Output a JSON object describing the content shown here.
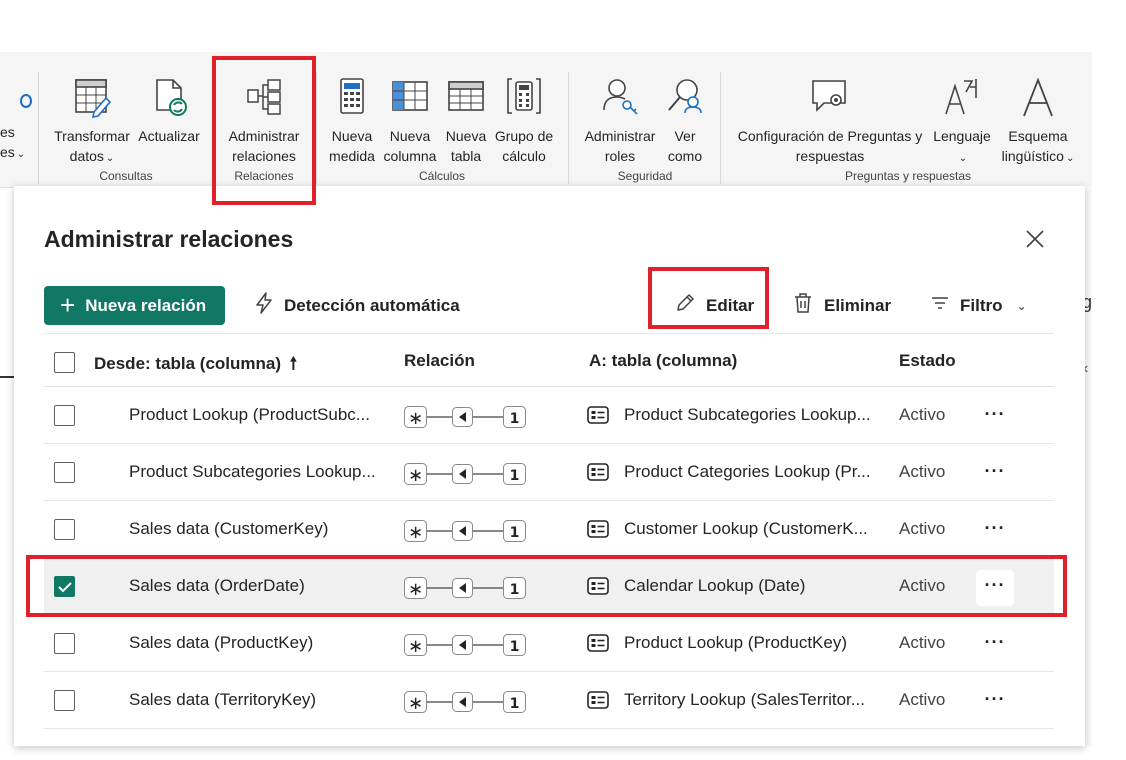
{
  "ribbon": {
    "partial_left": {
      "line1": "es",
      "line2": "es"
    },
    "transform": {
      "line1": "Transformar",
      "line2": "datos"
    },
    "refresh": {
      "line1": "Actualizar"
    },
    "manage_rel": {
      "line1": "Administrar",
      "line2": "relaciones"
    },
    "new_measure": {
      "line1": "Nueva",
      "line2": "medida"
    },
    "new_column": {
      "line1": "Nueva",
      "line2": "columna"
    },
    "new_table": {
      "line1": "Nueva",
      "line2": "tabla"
    },
    "calc_group": {
      "line1": "Grupo de",
      "line2": "cálculo"
    },
    "manage_roles": {
      "line1": "Administrar",
      "line2": "roles"
    },
    "view_as": {
      "line1": "Ver",
      "line2": "como"
    },
    "qa_config": {
      "line1": "Configuración de Preguntas y",
      "line2": "respuestas"
    },
    "language": {
      "line1": "Lenguaje"
    },
    "schema": {
      "line1": "Esquema",
      "line2": "lingüístico"
    },
    "groups": {
      "consultas": "Consultas",
      "relaciones": "Relaciones",
      "calculos": "Cálculos",
      "seguridad": "Seguridad",
      "qa": "Preguntas y respuestas"
    }
  },
  "dialog": {
    "title": "Administrar relaciones",
    "toolbar": {
      "new": "Nueva relación",
      "autodetect": "Detección automática",
      "edit": "Editar",
      "delete": "Eliminar",
      "filter": "Filtro"
    },
    "columns": {
      "from": "Desde: tabla (columna)",
      "relation": "Relación",
      "to": "A: tabla (columna)",
      "status": "Estado"
    },
    "rows": [
      {
        "from": "Product Lookup (ProductSubc...",
        "to": "Product Subcategories Lookup...",
        "status": "Activo",
        "checked": false,
        "many": "∗",
        "one": "1"
      },
      {
        "from": "Product Subcategories Lookup...",
        "to": "Product Categories Lookup (Pr...",
        "status": "Activo",
        "checked": false,
        "many": "∗",
        "one": "1"
      },
      {
        "from": "Sales data (CustomerKey)",
        "to": "Customer Lookup (CustomerK...",
        "status": "Activo",
        "checked": false,
        "many": "∗",
        "one": "1"
      },
      {
        "from": "Sales data (OrderDate)",
        "to": "Calendar Lookup (Date)",
        "status": "Activo",
        "checked": true,
        "many": "∗",
        "one": "1"
      },
      {
        "from": "Sales data (ProductKey)",
        "to": "Product Lookup (ProductKey)",
        "status": "Activo",
        "checked": false,
        "many": "∗",
        "one": "1"
      },
      {
        "from": "Sales data (TerritoryKey)",
        "to": "Territory Lookup (SalesTerritor...",
        "status": "Activo",
        "checked": false,
        "many": "∗",
        "one": "1"
      }
    ],
    "more_label": "···"
  },
  "colors": {
    "accent": "#117865",
    "highlight": "#e0202a"
  }
}
